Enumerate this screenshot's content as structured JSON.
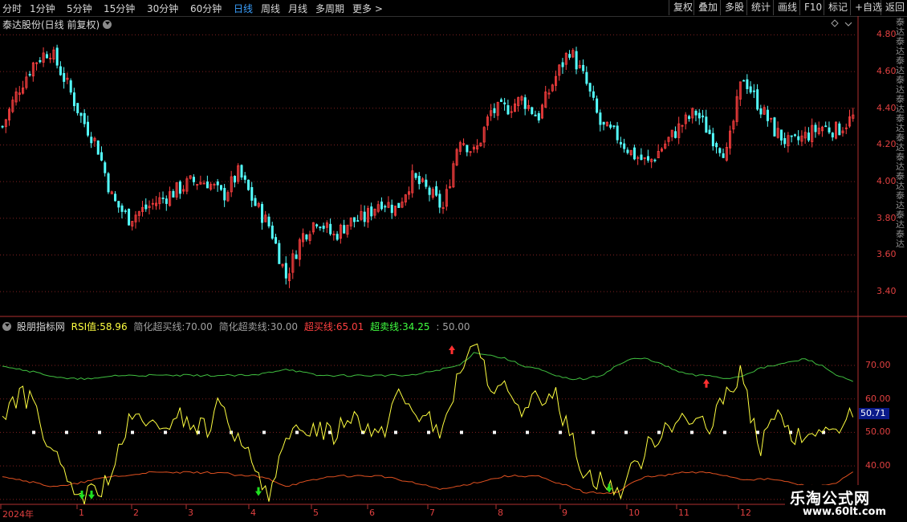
{
  "toolbar": {
    "periods": [
      "分时",
      "1分钟",
      "5分钟",
      "15分钟",
      "30分钟",
      "60分钟",
      "日线",
      "周线",
      "月线",
      "多周期",
      "更多 >"
    ],
    "active_period": "日线",
    "buttons": [
      "复权",
      "叠加",
      "多股",
      "统计",
      "画线",
      "F10",
      "标记",
      "+自选",
      "返回"
    ]
  },
  "price_panel": {
    "title": "泰达股份(日线 前复权)",
    "y_ticks": [
      "4.80",
      "4.60",
      "4.40",
      "4.20",
      "4.00",
      "3.80",
      "3.60",
      "3.40"
    ]
  },
  "indicator_panel": {
    "name": "股朋指标网",
    "rsi_label": "RSI值:",
    "rsi_value": "58.96",
    "simple_ob_label": "简化超买线:",
    "simple_ob_value": "70.00",
    "simple_os_label": "简化超卖线:",
    "simple_os_value": "30.00",
    "ob_label": "超买线:",
    "ob_value": "65.01",
    "os_label": "超卖线:",
    "os_value": "34.25",
    "mid_value": ": 50.00",
    "y_ticks": [
      "70.00",
      "60.00",
      "50.00",
      "40.00"
    ],
    "cursor_value": "50.71"
  },
  "x_axis": {
    "labels": [
      "2024年",
      "1",
      "2",
      "3",
      "4",
      "5",
      "6",
      "7",
      "8",
      "9",
      "10",
      "11",
      "12"
    ]
  },
  "right_strip_text": "泰达泰达泰达泰达泰达泰达泰达泰达泰达泰达泰达泰达",
  "watermark": {
    "cn": "乐淘公式网",
    "url": "www.60lt.com"
  },
  "colors": {
    "up": "#ff4040",
    "down": "#54ffff",
    "rsi": "#ffff40",
    "upper_band": "#40c040",
    "lower_band": "#e05020",
    "grid": "#802020",
    "active_tab": "#3aa0ff"
  },
  "chart_data": [
    {
      "type": "candlestick",
      "title": "泰达股份(日线 前复权)",
      "ylim": [
        3.3,
        4.85
      ],
      "x_labels": [
        "2024年",
        "1",
        "2",
        "3",
        "4",
        "5",
        "6",
        "7",
        "8",
        "9",
        "10",
        "11",
        "12"
      ],
      "close_path": [
        4.3,
        4.5,
        4.65,
        4.72,
        4.55,
        4.35,
        4.2,
        3.9,
        3.8,
        3.85,
        3.9,
        3.95,
        4.0,
        4.0,
        3.92,
        4.05,
        3.88,
        3.75,
        3.48,
        3.7,
        3.8,
        3.7,
        3.78,
        3.8,
        3.9,
        3.85,
        4.02,
        3.95,
        3.85,
        4.25,
        4.15,
        4.38,
        4.4,
        4.45,
        4.35,
        4.55,
        4.72,
        4.55,
        4.3,
        4.25,
        4.15,
        4.1,
        4.2,
        4.3,
        4.38,
        4.25,
        4.15,
        4.58,
        4.42,
        4.28,
        4.2,
        4.25,
        4.3,
        4.28,
        4.35
      ]
    },
    {
      "type": "line",
      "title": "股朋指标网",
      "ylim": [
        29,
        82
      ],
      "series": [
        {
          "name": "RSI值",
          "values": [
            55,
            61,
            59,
            46,
            35,
            31,
            32,
            38,
            52,
            55,
            48,
            56,
            52,
            51,
            60,
            46,
            40,
            32,
            46,
            51,
            52,
            49,
            56,
            53,
            48,
            62,
            57,
            54,
            49,
            69,
            75,
            65,
            62,
            53,
            61,
            62,
            50,
            38,
            36,
            32,
            38,
            46,
            52,
            55,
            52,
            51,
            62,
            68,
            44,
            56,
            49,
            47,
            52,
            48,
            57
          ]
        },
        {
          "name": "超买线",
          "values": [
            70,
            69,
            68,
            67,
            66,
            66,
            66,
            67,
            67,
            67,
            67,
            67,
            67,
            67,
            67,
            67,
            67,
            68,
            69,
            68,
            67,
            67,
            67,
            67,
            67,
            67,
            67,
            68,
            69,
            70,
            74,
            73,
            72,
            70,
            69,
            67,
            66,
            66,
            67,
            70,
            72,
            72,
            70,
            68,
            67,
            67,
            66,
            67,
            69,
            70,
            71,
            72,
            70,
            67,
            65
          ]
        },
        {
          "name": "超卖线",
          "values": [
            37,
            36,
            35,
            34,
            34,
            35,
            36,
            37,
            37,
            38,
            38,
            38,
            38,
            38,
            38,
            37,
            37,
            36,
            34,
            35,
            36,
            37,
            37,
            37,
            37,
            36,
            35,
            34,
            33,
            34,
            35,
            36,
            37,
            37,
            37,
            35,
            34,
            32,
            32,
            32,
            35,
            37,
            37,
            38,
            38,
            38,
            37,
            36,
            36,
            36,
            35,
            34,
            34,
            35,
            38
          ]
        },
        {
          "name": "简化超买线",
          "values": [
            70
          ]
        },
        {
          "name": "简化超卖线",
          "values": [
            30
          ]
        }
      ],
      "y_ticks": [
        70,
        60,
        50,
        40
      ]
    }
  ]
}
